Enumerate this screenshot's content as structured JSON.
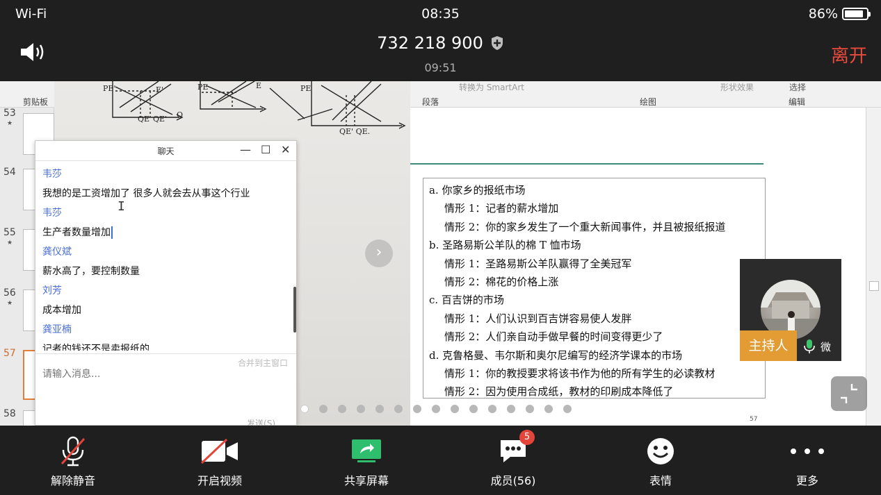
{
  "status": {
    "wifi": "Wi-Fi",
    "time": "08:35",
    "battery": "86%",
    "battery_fraction": 0.86
  },
  "meeting": {
    "id": "732 218 900",
    "duration": "09:51",
    "leave_label": "离开"
  },
  "ribbon": {
    "clipboard": "剪贴板",
    "paragraph": "段落",
    "drawing": "绘图",
    "editing": "编辑",
    "smartart": "转换为 SmartArt",
    "shape_effects": "形状效果",
    "select": "选择"
  },
  "slides": [
    {
      "num": "53",
      "star": "★"
    },
    {
      "num": "54",
      "star": ""
    },
    {
      "num": "55",
      "star": "★"
    },
    {
      "num": "56",
      "star": "★"
    },
    {
      "num": "57",
      "star": ""
    },
    {
      "num": "58",
      "star": ""
    }
  ],
  "slide_page": "57",
  "slide_lines": [
    "a.  你家乡的报纸市场",
    "情形 1：记者的薪水增加",
    "情形 2：你的家乡发生了一个重大新闻事件，并且被报纸报道",
    "b.  圣路易斯公羊队的棉 T 恤市场",
    "情形 1：圣路易斯公羊队赢得了全美冠军",
    "情形 2：棉花的价格上涨",
    "c.  百吉饼的市场",
    "情形 1：人们认识到百吉饼容易使人发胖",
    "情形 2：人们亲自动手做早餐的时间变得更少了",
    "d.  克鲁格曼、韦尔斯和奥尔尼编写的经济学课本的市场",
    "情形 1：你的教授要求将该书作为他的所有学生的必读教材",
    "情形 2：因为使用合成纸，教材的印刷成本降低了"
  ],
  "presenter": {
    "host_label": "主持人",
    "name": "微"
  },
  "chat": {
    "title": "聊天",
    "messages": [
      {
        "name": "韦莎",
        "text": "我想的是工资增加了   很多人就会去从事这个行业"
      },
      {
        "name": "韦莎",
        "text": "生产者数量增加"
      },
      {
        "name": "龚仪斌",
        "text": "薪水高了，要控制数量"
      },
      {
        "name": "刘芳",
        "text": "成本增加"
      },
      {
        "name": "龚亚楠",
        "text": "记者的钱还不是卖报纸的"
      }
    ],
    "merge_label": "合并到主窗口",
    "input_placeholder": "请输入消息...",
    "send_label": "发送(S)"
  },
  "toolbar": {
    "unmute": "解除静音",
    "start_video": "开启视频",
    "share_screen": "共享屏幕",
    "members": "成员(56)",
    "members_badge": "5",
    "emoji": "表情",
    "more": "更多"
  },
  "colors": {
    "accent_red": "#e84b3c",
    "host_orange": "#e39b34",
    "share_green": "#2fbd6e",
    "chat_name_blue": "#4a6fd6"
  },
  "page_dots": {
    "count": 15,
    "active_index": 0
  }
}
